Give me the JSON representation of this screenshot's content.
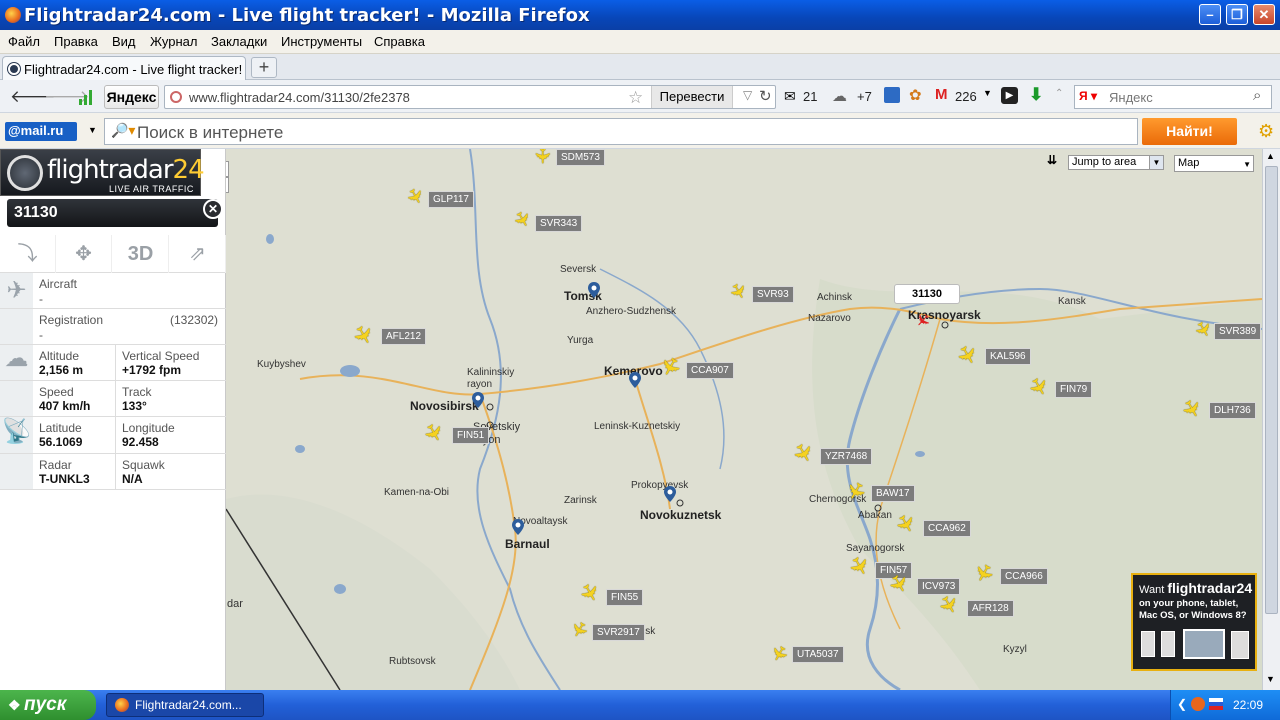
{
  "window": {
    "title": "Flightradar24.com - Live flight tracker! - Mozilla Firefox"
  },
  "menu": [
    "Файл",
    "Правка",
    "Вид",
    "Журнал",
    "Закладки",
    "Инструменты",
    "Справка"
  ],
  "tab": {
    "label": "Flightradar24.com - Live flight tracker!"
  },
  "nav": {
    "yandex_button": "Яндекс",
    "url": "www.flightradar24.com/31130/2fe2378",
    "translate": "Перевести",
    "mail_count": "21",
    "weather": "+7",
    "gmail_count": "226",
    "search_placeholder": "Яндекс"
  },
  "mailbar": {
    "logo": "@mail.ru",
    "search_placeholder": "Поиск в интернете",
    "find_button": "Найти!"
  },
  "panel": {
    "logo_main": "flightradar",
    "logo_num": "24",
    "logo_sub": "LIVE AIR TRAFFIC",
    "flight_id": "31130",
    "tools": [
      "route-icon",
      "fit-icon",
      "3D",
      "share-icon"
    ],
    "aircraft_label": "Aircraft",
    "aircraft_value": "-",
    "registration_label": "Registration",
    "registration_code": "(132302)",
    "registration_value": "-",
    "altitude_label": "Altitude",
    "altitude_value": "2,156 m",
    "vspeed_label": "Vertical Speed",
    "vspeed_value": "+1792 fpm",
    "speed_label": "Speed",
    "speed_value": "407 km/h",
    "track_label": "Track",
    "track_value": "133°",
    "lat_label": "Latitude",
    "lat_value": "56.1069",
    "lon_label": "Longitude",
    "lon_value": "92.458",
    "radar_label": "Radar",
    "radar_value": "T-UNKL3",
    "squawk_label": "Squawk",
    "squawk_value": "N/A"
  },
  "map": {
    "jump_label": "Jump to area",
    "maptype_label": "Map",
    "selected_label": "31130",
    "cities": [
      {
        "name": "Seversk"
      },
      {
        "name": "Tomsk"
      },
      {
        "name": "Anzhero-Sudzhensk"
      },
      {
        "name": "Yurga"
      },
      {
        "name": "Kuybyshev"
      },
      {
        "name": "Kalininskiy rayon"
      },
      {
        "name": "Novosibirsk"
      },
      {
        "name": "Sovetskiy rayon"
      },
      {
        "name": "Kemerovo"
      },
      {
        "name": "Leninsk-Kuznetskiy"
      },
      {
        "name": "Kamen-na-Obi"
      },
      {
        "name": "Zarinsk"
      },
      {
        "name": "Prokopyevsk"
      },
      {
        "name": "Novokuznetsk"
      },
      {
        "name": "Novoaltaysk"
      },
      {
        "name": "Barnaul"
      },
      {
        "name": "Rubtsovsk"
      },
      {
        "name": "Achinsk"
      },
      {
        "name": "Nazarovo"
      },
      {
        "name": "Krasnoyarsk"
      },
      {
        "name": "Kansk"
      },
      {
        "name": "Chernogorsk"
      },
      {
        "name": "Abakan"
      },
      {
        "name": "Sayanogorsk"
      },
      {
        "name": "Kyzyl"
      },
      {
        "name": "dar"
      },
      {
        "name": "lsk"
      }
    ],
    "flights": [
      {
        "label": "SDM573"
      },
      {
        "label": "GLP117"
      },
      {
        "label": "SVR343"
      },
      {
        "label": "SVR93"
      },
      {
        "label": "AFL212"
      },
      {
        "label": "CCA907"
      },
      {
        "label": "FIN51"
      },
      {
        "label": "KAL596"
      },
      {
        "label": "FIN79"
      },
      {
        "label": "SVR389"
      },
      {
        "label": "DLH736"
      },
      {
        "label": "YZR7468"
      },
      {
        "label": "BAW17"
      },
      {
        "label": "CCA962"
      },
      {
        "label": "FIN57"
      },
      {
        "label": "ICV973"
      },
      {
        "label": "CCA966"
      },
      {
        "label": "AFR128"
      },
      {
        "label": "FIN55"
      },
      {
        "label": "SVR2917"
      },
      {
        "label": "UTA5037"
      }
    ],
    "ad": {
      "want": "Want",
      "brand": "flightradar24",
      "line1": "on your phone, tablet,",
      "line2": "Mac OS, or Windows 8?"
    }
  },
  "taskbar": {
    "start": "пуск",
    "item": "Flightradar24.com...",
    "clock": "22:09"
  }
}
